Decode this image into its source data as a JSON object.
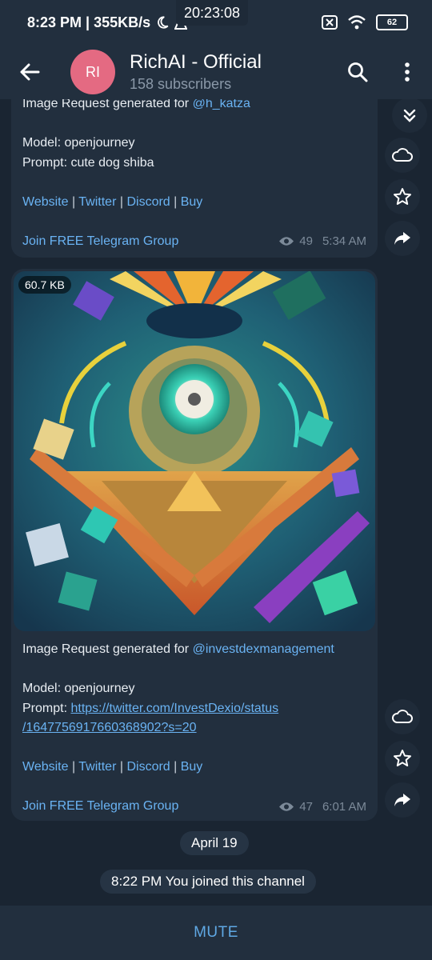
{
  "status_bar": {
    "time_speed": "8:23 PM | 355KB/s",
    "clock_overlay": "20:23:08",
    "battery": "62"
  },
  "header": {
    "avatar_initials": "RI",
    "title": "RichAI - Official",
    "subtitle": "158 subscribers"
  },
  "messages": [
    {
      "line1_prefix": "Image Request generated for ",
      "line1_mention": "@h_katza",
      "model": "Model: openjourney",
      "prompt": "Prompt: cute dog shiba",
      "links": [
        "Website",
        "Twitter",
        "Discord",
        "Buy"
      ],
      "join_link": "Join FREE Telegram Group",
      "views": "49",
      "time": "5:34 AM"
    },
    {
      "media_size": "60.7 KB",
      "line1_prefix": "Image Request generated for ",
      "line1_mention": "@investdexmanagement",
      "model": "Model: openjourney",
      "prompt_label": "Prompt: ",
      "prompt_url_line1": "https://twitter.com/InvestDexio/status",
      "prompt_url_line2": "/1647756917660368902?s=20",
      "links": [
        "Website",
        "Twitter",
        "Discord",
        "Buy"
      ],
      "join_link": "Join FREE Telegram Group",
      "views": "47",
      "time": "6:01 AM"
    }
  ],
  "date_separator": "April 19",
  "service_message": "8:22 PM You joined this channel",
  "bottom": {
    "mute_label": "MUTE"
  }
}
